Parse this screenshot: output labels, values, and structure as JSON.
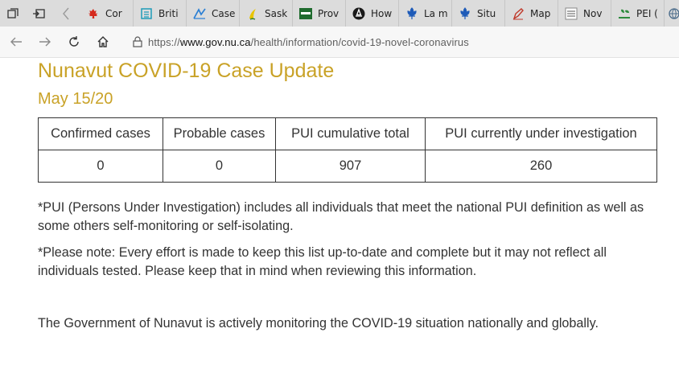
{
  "browser": {
    "tabs": [
      {
        "title": "Cor",
        "icon": "canada-flag-icon"
      },
      {
        "title": "Briti",
        "icon": "bc-flag-icon"
      },
      {
        "title": "Case",
        "icon": "chart-icon"
      },
      {
        "title": "Sask",
        "icon": "saskatchewan-icon"
      },
      {
        "title": "Prov",
        "icon": "provincial-icon"
      },
      {
        "title": "How",
        "icon": "ontario-trillium-icon"
      },
      {
        "title": "La m",
        "icon": "quebec-fleurdelis-icon"
      },
      {
        "title": "Situ",
        "icon": "quebec-fleurdelis-icon"
      },
      {
        "title": "Map",
        "icon": "map-pen-icon"
      },
      {
        "title": "Nov",
        "icon": "novascotia-icon"
      },
      {
        "title": "PEI (",
        "icon": "pei-tree-icon"
      }
    ],
    "url_prefix": "https://",
    "url_host": "www.gov.nu.ca",
    "url_path": "/health/information/covid-19-novel-coronavirus"
  },
  "page": {
    "title": "Nunavut COVID-19 Case Update",
    "date": "May 15/20",
    "table": {
      "headers": [
        "Confirmed cases",
        "Probable cases",
        "PUI cumulative total",
        "PUI currently under investigation"
      ],
      "values": [
        "0",
        "0",
        "907",
        "260"
      ]
    },
    "note_pui": "*PUI (Persons Under Investigation) includes all individuals that meet the national PUI definition as well as some others self-monitoring or self-isolating.",
    "note_disclaimer": "*Please note: Every effort is made to keep this list up-to-date and complete but it may not reflect all individuals tested. Please keep that in mind when reviewing this information.",
    "monitoring": "The Government of Nunavut is actively monitoring the COVID-19 situation nationally and globally."
  },
  "colors": {
    "heading": "#c9a227",
    "text": "#333333",
    "tabbar": "#dcdcdc"
  }
}
